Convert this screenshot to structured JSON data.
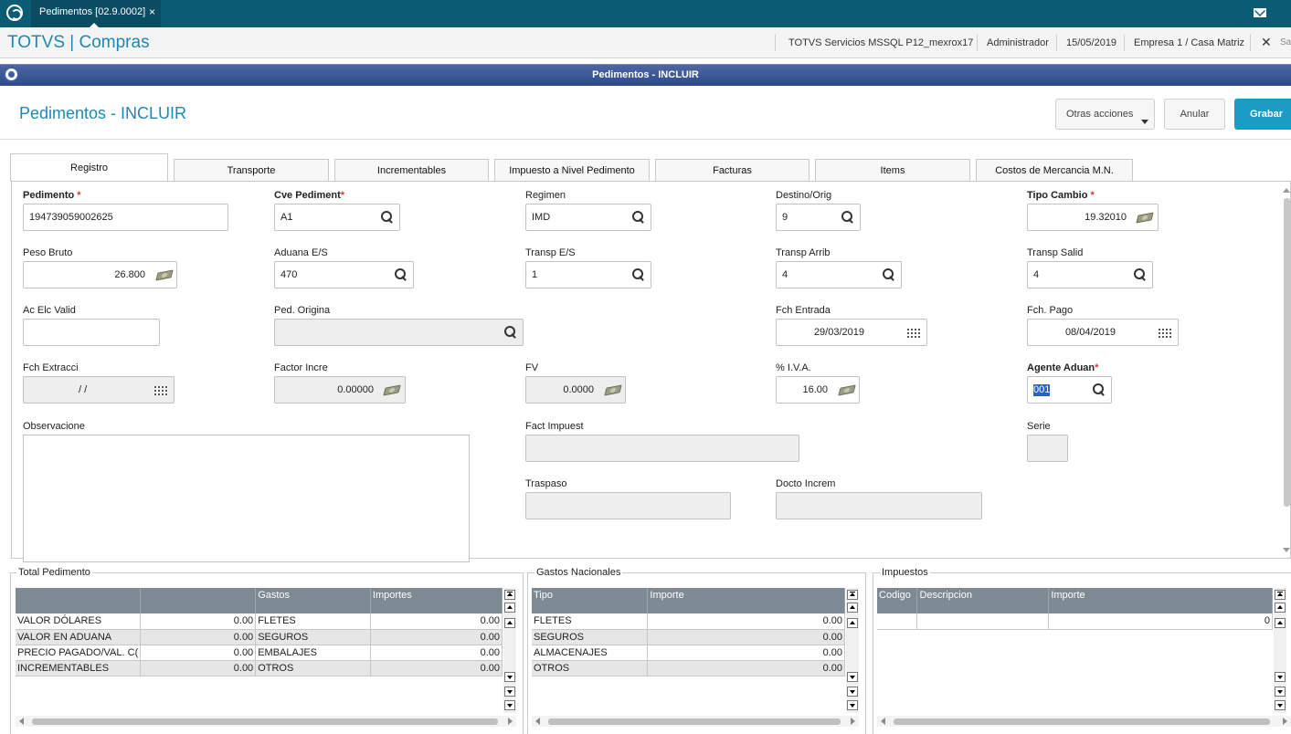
{
  "topbar": {
    "tab_label": "Pedimentos [02.9.0002]",
    "tab_close": "×"
  },
  "header": {
    "brand": "TOTVS | Compras",
    "environment": "TOTVS Servicios MSSQL P12_mexrox17",
    "user": "Administrador",
    "date": "15/05/2019",
    "company": "Empresa 1 / Casa Matriz",
    "close": "✕",
    "truncated": "Sa"
  },
  "window_title": "Pedimentos - INCLUIR",
  "page_title": "Pedimentos - INCLUIR",
  "actions": {
    "other": "Otras acciones",
    "cancel": "Anular",
    "save": "Grabar"
  },
  "tabs": [
    "Registro",
    "Transporte",
    "Incrementables",
    "Impuesto a Nivel Pedimento",
    "Facturas",
    "Items",
    "Costos de Mercancia M.N."
  ],
  "fields": {
    "pedimento": {
      "label": "Pedimento",
      "value": "194739059002625"
    },
    "cve_pediment": {
      "label": "Cve Pediment",
      "value": "A1"
    },
    "regimen": {
      "label": "Regimen",
      "value": "IMD"
    },
    "destino": {
      "label": "Destino/Orig",
      "value": "9"
    },
    "tipo_cambio": {
      "label": "Tipo Cambio",
      "value": "19.32010"
    },
    "peso_bruto": {
      "label": "Peso Bruto",
      "value": "26.800"
    },
    "aduana": {
      "label": "Aduana E/S",
      "value": "470"
    },
    "transp_es": {
      "label": "Transp E/S",
      "value": "1"
    },
    "transp_arrib": {
      "label": "Transp Arrib",
      "value": "4"
    },
    "transp_salid": {
      "label": "Transp Salid",
      "value": "4"
    },
    "ac_elc": {
      "label": "Ac Elc Valid",
      "value": ""
    },
    "ped_origina": {
      "label": "Ped. Origina",
      "value": ""
    },
    "fch_entrada": {
      "label": "Fch Entrada",
      "value": "29/03/2019"
    },
    "fch_pago": {
      "label": "Fch. Pago",
      "value": "08/04/2019"
    },
    "fch_extracci": {
      "label": "Fch Extracci",
      "value": "/ /"
    },
    "factor_incre": {
      "label": "Factor Incre",
      "value": "0.00000"
    },
    "fv": {
      "label": "FV",
      "value": "0.0000"
    },
    "iva": {
      "label": "% I.V.A.",
      "value": "16.00"
    },
    "agente": {
      "label": "Agente Aduan",
      "value": "001"
    },
    "observacione": {
      "label": "Observacione"
    },
    "fact_impuest": {
      "label": "Fact Impuest"
    },
    "serie": {
      "label": "Serie"
    },
    "traspaso": {
      "label": "Traspaso"
    },
    "docto_increm": {
      "label": "Docto Increm"
    },
    "required_mark": "*"
  },
  "total_pedimento": {
    "title": "Total Pedimento",
    "headers": [
      "",
      "",
      "Gastos",
      "Importes"
    ],
    "rows": [
      [
        "VALOR DÓLARES",
        "0.00",
        "FLETES",
        "0.00"
      ],
      [
        "VALOR EN ADUANA",
        "0.00",
        "SEGUROS",
        "0.00"
      ],
      [
        "PRECIO PAGADO/VAL. C(",
        "0.00",
        "EMBALAJES",
        "0.00"
      ],
      [
        "INCREMENTABLES",
        "0.00",
        "OTROS",
        "0.00"
      ]
    ]
  },
  "gastos_nacionales": {
    "title": "Gastos Nacionales",
    "headers": [
      "Tipo",
      "Importe"
    ],
    "rows": [
      [
        "FLETES",
        "0.00"
      ],
      [
        "SEGUROS",
        "0.00"
      ],
      [
        "ALMACENAJES",
        "0.00"
      ],
      [
        "OTROS",
        "0.00"
      ]
    ]
  },
  "impuestos": {
    "title": "Impuestos",
    "headers": [
      "Codigo",
      "Descripcion",
      "Importe"
    ],
    "rows": [
      [
        "",
        "",
        "0"
      ]
    ]
  },
  "icons": [
    "totvs-logo-icon",
    "mail-icon",
    "search-icon",
    "money-icon",
    "calendar-icon",
    "close-icon"
  ]
}
